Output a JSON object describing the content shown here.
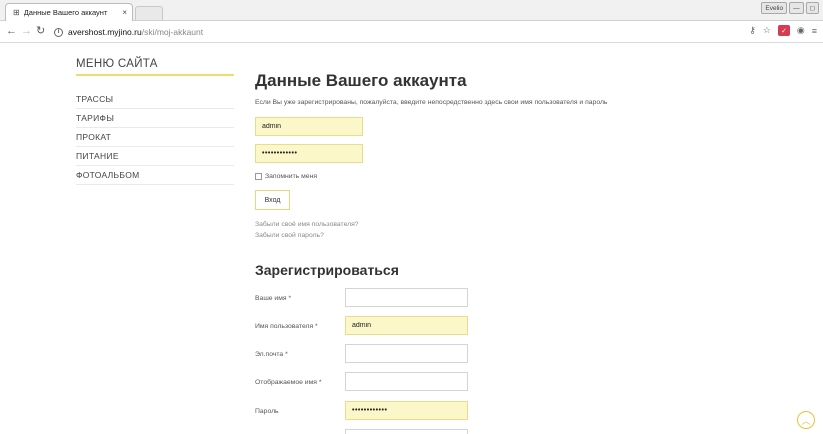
{
  "browser": {
    "tab_title": "Данные Вашего аккаунт",
    "tab_close": "×",
    "url_host": "avershost.myjino.ru",
    "url_path": "/ski/moj-akkaunt",
    "window_controls": {
      "profile": "Evelio",
      "minimize": "—",
      "restore": "◻"
    }
  },
  "sidebar": {
    "title": "МЕНЮ САЙТА",
    "items": [
      {
        "label": "ТРАССЫ"
      },
      {
        "label": "ТАРИФЫ"
      },
      {
        "label": "ПРОКАТ"
      },
      {
        "label": "ПИТАНИЕ"
      },
      {
        "label": "ФОТОАЛЬБОМ"
      }
    ]
  },
  "login": {
    "heading": "Данные Вашего аккаунта",
    "intro": "Если Вы уже зарегистрированы, пожалуйста, введите непосредственно здесь свои имя пользователя и пароль",
    "username_value": "admin",
    "password_value": "••••••••••••",
    "remember_label": "Запомнить меня",
    "submit_label": "Вход",
    "forgot_username": "Забыли своё имя пользователя?",
    "forgot_password": "Забыли свой пароль?"
  },
  "register": {
    "heading": "Зарегистрироваться",
    "fields": [
      {
        "label": "Ваше имя *",
        "value": ""
      },
      {
        "label": "Имя пользователя *",
        "value": "admin"
      },
      {
        "label": "Эл.почта *",
        "value": ""
      },
      {
        "label": "Отображаемое имя *",
        "value": ""
      },
      {
        "label": "Пароль",
        "value": "••••••••••••"
      }
    ]
  },
  "colors": {
    "accent": "#f0dc6a",
    "autofill": "#fcf7c8",
    "scroll_button": "#e8c23c"
  }
}
